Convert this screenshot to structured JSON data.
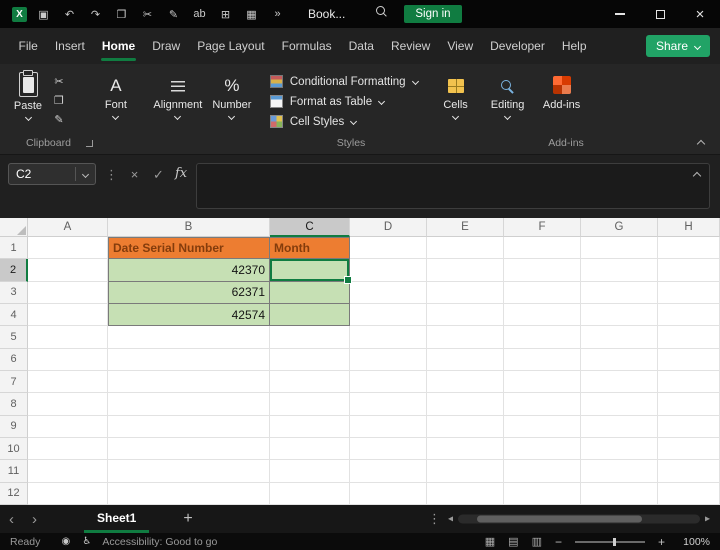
{
  "colors": {
    "accent_green": "#107C41",
    "share_green": "#21A366",
    "addins_orange": "#D83B01"
  },
  "title_bar": {
    "logo_glyph": "X",
    "app_title": "Book...",
    "sign_in_label": "Sign in",
    "close_glyph": "×",
    "icons": [
      {
        "name": "save-icon",
        "glyph": "▣"
      },
      {
        "name": "undo-icon",
        "glyph": "↶"
      },
      {
        "name": "redo-icon",
        "glyph": "↷"
      },
      {
        "name": "paste-icon",
        "glyph": "❐"
      },
      {
        "name": "cut-icon",
        "glyph": "✂"
      },
      {
        "name": "draw-icon",
        "glyph": "✎"
      },
      {
        "name": "underline-icon",
        "glyph": "ab"
      },
      {
        "name": "borders-icon",
        "glyph": "⊞"
      },
      {
        "name": "camera-icon",
        "glyph": "▦"
      },
      {
        "name": "more-commands-icon",
        "glyph": "»"
      }
    ]
  },
  "menu_bar": {
    "items": [
      "File",
      "Insert",
      "Home",
      "Draw",
      "Page Layout",
      "Formulas",
      "Data",
      "Review",
      "View",
      "Developer",
      "Help"
    ],
    "active": "Home",
    "share_label": "Share"
  },
  "ribbon": {
    "paste_label": "Paste",
    "clipboard_icons": [
      {
        "name": "cut-icon",
        "glyph": "✂"
      },
      {
        "name": "copy-icon",
        "glyph": "❐"
      },
      {
        "name": "format-painter-icon",
        "glyph": "✎"
      }
    ],
    "clipboard_group_label": "Clipboard",
    "font_label": "Font",
    "font_icon_glyph": "A",
    "alignment_label": "Alignment",
    "number_label": "Number",
    "number_icon_glyph": "%",
    "styles_items": [
      "Conditional Formatting",
      "Format as Table",
      "Cell Styles"
    ],
    "styles_group_label": "Styles",
    "cells_label": "Cells",
    "editing_label": "Editing",
    "addins_label": "Add-ins",
    "addins_group_label": "Add-ins"
  },
  "formula_bar": {
    "name_box_value": "C2",
    "menu_glyph": "⋮",
    "cancel_glyph": "×",
    "enter_glyph": "✓",
    "fx_label": "fx",
    "formula_value": ""
  },
  "grid": {
    "column_headers": [
      "A",
      "B",
      "C",
      "D",
      "E",
      "F",
      "G",
      "H"
    ],
    "row_headers": [
      "1",
      "2",
      "3",
      "4",
      "5",
      "6",
      "7",
      "8",
      "9",
      "10",
      "11",
      "12"
    ],
    "selected_cell": "C2",
    "selected_column": "C",
    "selected_row": "2",
    "cells": [
      {
        "ref": "B1",
        "value": "Date Serial Number",
        "style": "header"
      },
      {
        "ref": "C1",
        "value": "Month",
        "style": "header"
      },
      {
        "ref": "B2",
        "value": "42370",
        "style": "data"
      },
      {
        "ref": "C2",
        "value": "",
        "style": "data"
      },
      {
        "ref": "B3",
        "value": "62371",
        "style": "data"
      },
      {
        "ref": "C3",
        "value": "",
        "style": "data"
      },
      {
        "ref": "B4",
        "value": "42574",
        "style": "data"
      },
      {
        "ref": "C4",
        "value": "",
        "style": "data"
      }
    ],
    "colors": {
      "table_header_bg": "#ED7D31",
      "table_header_text": "#843C0C",
      "data_cell_bg": "#C6E0B4",
      "selection_border": "#107C41"
    }
  },
  "sheet_tabs": {
    "prev_glyph": "‹",
    "next_glyph": "›",
    "add_glyph": "+",
    "menu_glyph": "⋮",
    "scroll_left_glyph": "◂",
    "scroll_right_glyph": "▸",
    "tabs": [
      {
        "label": "Sheet1",
        "active": true
      }
    ]
  },
  "status_bar": {
    "ready_label": "Ready",
    "status_icons": [
      {
        "name": "macro-record-icon",
        "glyph": "◉"
      },
      {
        "name": "accessibility-icon",
        "glyph": "♿"
      }
    ],
    "accessibility_label": "Accessibility: Good to go",
    "view_icons": [
      {
        "name": "normal-view-icon",
        "glyph": "▦"
      },
      {
        "name": "page-layout-view-icon",
        "glyph": "▤"
      },
      {
        "name": "page-break-view-icon",
        "glyph": "▥"
      }
    ],
    "zoom_out_glyph": "−",
    "zoom_in_glyph": "+",
    "zoom_level": "100%"
  }
}
